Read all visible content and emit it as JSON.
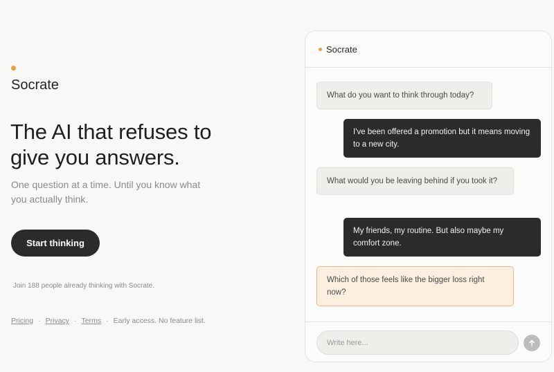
{
  "brand": {
    "name": "Socrate"
  },
  "hero": {
    "headline": "The AI that refuses to give you answers.",
    "subhead": "One question at a time. Until you know what you actually think.",
    "cta_label": "Start thinking",
    "social_proof": "Join 188 people already thinking with Socrate."
  },
  "footer": {
    "links": [
      "Pricing",
      "Privacy",
      "Terms"
    ],
    "note": "Early access. No feature list."
  },
  "chat": {
    "title": "Socrate",
    "messages": [
      {
        "role": "ai",
        "text": "What do you want to think through today?"
      },
      {
        "role": "user",
        "text": "I've been offered a promotion but it means moving to a new city."
      },
      {
        "role": "ai",
        "text": "What would you be leaving behind if you took it?"
      },
      {
        "role": "user",
        "text": "My friends, my routine. But also maybe my comfort zone."
      },
      {
        "role": "ai",
        "text": "Which of those feels like the bigger loss right now?"
      }
    ],
    "input_placeholder": "Write here...",
    "send_icon": "arrow-up-icon"
  },
  "colors": {
    "accent": "#e8a13a",
    "dark": "#2b2b2a",
    "highlight_bg": "#fcefdf",
    "highlight_border": "#e5b98a"
  }
}
